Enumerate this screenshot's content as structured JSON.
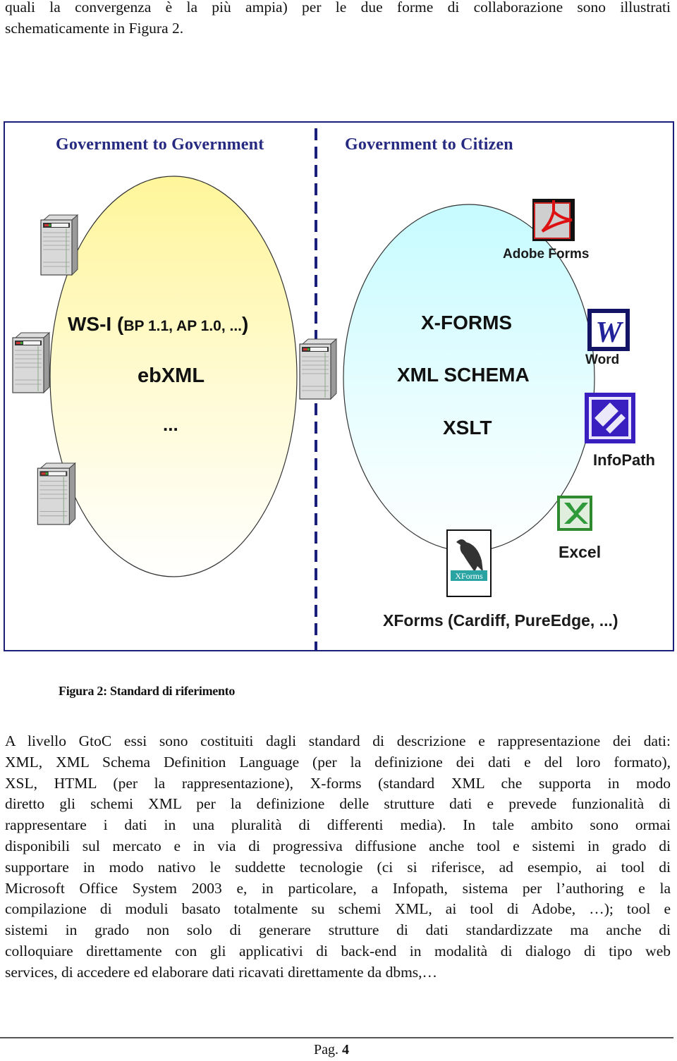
{
  "intro": {
    "lines": [
      "quali la convergenza è la più ampia) per le due forme di collaborazione sono illustrati",
      "schematicamente in Figura 2."
    ]
  },
  "figure": {
    "left_header": "Government to Government",
    "right_header": "Government to Citizen",
    "left_standards": {
      "wsi_main": "WS-I (",
      "wsi_detail": "BP 1.1, AP 1.0, ...",
      "wsi_close": ")",
      "ebxml": "ebXML",
      "more": "..."
    },
    "right_standards": {
      "xforms": "X-FORMS",
      "xml_schema": "XML SCHEMA",
      "xslt": "XSLT"
    },
    "tools": {
      "adobe": "Adobe Forms",
      "word": "Word",
      "infopath": "InfoPath",
      "excel": "Excel",
      "xforms_book": "XForms",
      "xforms_vendors": "XForms (Cardiff, PureEdge, ...)"
    },
    "colors": {
      "border": "#1a1f7a",
      "header": "#262a80",
      "left_ellipse_top": "#fff59a",
      "right_ellipse_top": "#c6fbff"
    }
  },
  "caption": "Figura 2: Standard di riferimento",
  "body": {
    "lines": [
      "A livello GtoC essi sono costituiti dagli standard di descrizione e rappresentazione dei dati:",
      "XML, XML Schema Definition Language (per la definizione dei dati e del loro formato),",
      "XSL, HTML (per la rappresentazione), X-forms (standard XML che supporta in modo",
      "diretto gli schemi XML per la definizione delle strutture dati e prevede funzionalità di",
      "rappresentare i dati in una pluralità di differenti media). In tale ambito sono ormai",
      "disponibili sul mercato e in via di progressiva diffusione anche tool e sistemi in grado di",
      "supportare in modo nativo le suddette tecnologie (ci si riferisce, ad esempio, ai tool di",
      "Microsoft Office System 2003 e, in particolare, a Infopath, sistema per l’authoring e la",
      "compilazione di moduli basato totalmente su schemi XML, ai tool di Adobe, …); tool e",
      "sistemi in grado non solo di generare strutture di dati standardizzate ma anche di",
      "colloquiare direttamente con gli applicativi di back-end in modalità di dialogo di tipo web",
      "services, di accedere ed elaborare dati ricavati direttamente da dbms,…"
    ]
  },
  "footer": {
    "page_prefix": "Pag.",
    "page_number": "4"
  }
}
